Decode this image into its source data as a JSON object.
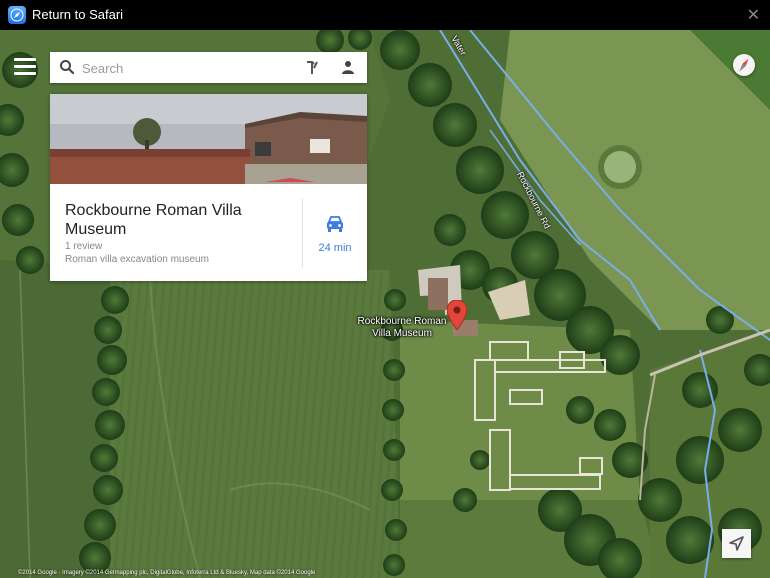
{
  "topbar": {
    "app_icon": "safari-compass-icon",
    "return_label": "Return to Safari",
    "close_icon": "close-icon",
    "close_glyph": "✕"
  },
  "search": {
    "placeholder": "Search",
    "value": "",
    "menu_icon": "hamburger-menu-icon",
    "directions_icon": "directions-icon",
    "account_icon": "person-icon"
  },
  "place_card": {
    "name": "Rockbourne Roman Villa Museum",
    "reviews": "1 review",
    "description": "Roman villa excavation museum",
    "drive_time": "24 min",
    "drive_icon": "car-icon"
  },
  "map": {
    "poi_label_line1": "Rockbourne Roman",
    "poi_label_line2": "Villa Museum",
    "road_labels": [
      "Rockbourne Rd",
      "Vater"
    ],
    "attribution": "©2014 Google · Imagery ©2014 Getmapping plc, DigitalGlobe, Infoterra Ltd & Bluesky, Map data ©2014 Google",
    "compass_icon": "compass-icon",
    "locate_icon": "my-location-arrow-icon",
    "pin_icon": "map-pin-icon"
  },
  "colors": {
    "link_blue": "#3b7de0",
    "pin_red": "#e0463a",
    "river_blue": "#79aee8"
  }
}
